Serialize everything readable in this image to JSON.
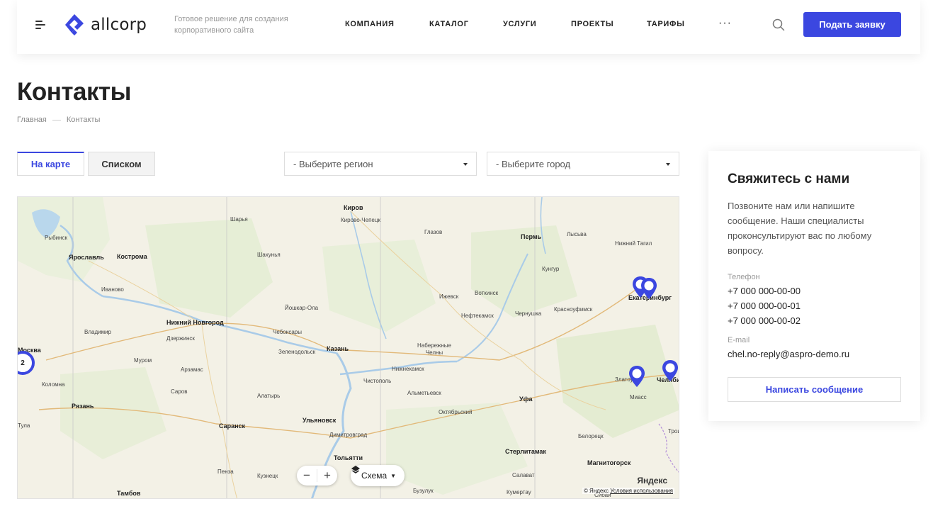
{
  "header": {
    "logo_text": "allcorp",
    "slogan": "Готовое решение для создания корпоративного сайта",
    "nav": [
      "КОМПАНИЯ",
      "КАТАЛОГ",
      "УСЛУГИ",
      "ПРОЕКТЫ",
      "ТАРИФЫ"
    ],
    "more_label": "···",
    "cta_label": "Подать заявку",
    "brand_color": "#3b47e0"
  },
  "page": {
    "title": "Контакты",
    "breadcrumb": [
      "Главная",
      "Контакты"
    ]
  },
  "view_tabs": {
    "map": "На карте",
    "list": "Списком",
    "active": "map"
  },
  "filters": {
    "region_placeholder": "- Выберите регион",
    "city_placeholder": "- Выберите город"
  },
  "map": {
    "cities": [
      "Киров",
      "Кирово-Чепецк",
      "Шарья",
      "Рыбинск",
      "Ярославль",
      "Кострома",
      "Шахунья",
      "Глазов",
      "Пермь",
      "Лысьва",
      "Нижний Тагил",
      "Иваново",
      "Кунгур",
      "Ижевск",
      "Воткинск",
      "Йошкар-Ола",
      "Чернушка",
      "Красноуфимск",
      "Нижний Новгород",
      "Владимир",
      "Дзержинск",
      "Чебоксары",
      "Нефтекамск",
      "Набережные Челны",
      "Зеленодольск",
      "Казань",
      "Муром",
      "Арзамас",
      "Нижнекамск",
      "Чистополь",
      "Альметьевск",
      "Коломна",
      "Саров",
      "Рязань",
      "Алатырь",
      "Уфа",
      "Октябрьский",
      "Тула",
      "Саранск",
      "Ульяновск",
      "Димитровград",
      "Белорецк",
      "Миасс",
      "Стерлитамак",
      "Тольятти",
      "Магнитогорск",
      "Пенза",
      "Кузнецк",
      "Салават",
      "Тамбов",
      "Бузулук",
      "Кумертау",
      "Екатеринбург",
      "Челябинск",
      "Златоуст",
      "Москва",
      "Троицк",
      "Сибай"
    ],
    "cluster_count": "2",
    "layers_label": "Схема",
    "zoom_out": "−",
    "zoom_in": "+",
    "copyright": "© Яндекс",
    "terms_link": "Условия использования",
    "provider_logo": "Яндекс"
  },
  "contact": {
    "title": "Свяжитесь с нами",
    "description": "Позвоните нам или напишите сообщение. Наши специалисты проконсультируют вас по любому вопросу.",
    "phone_label": "Телефон",
    "phones": [
      "+7 000 000-00-00",
      "+7 000 000-00-01",
      "+7 000 000-00-02"
    ],
    "email_label": "E-mail",
    "email": "chel.no-reply@aspro-demo.ru",
    "button_label": "Написать сообщение"
  }
}
